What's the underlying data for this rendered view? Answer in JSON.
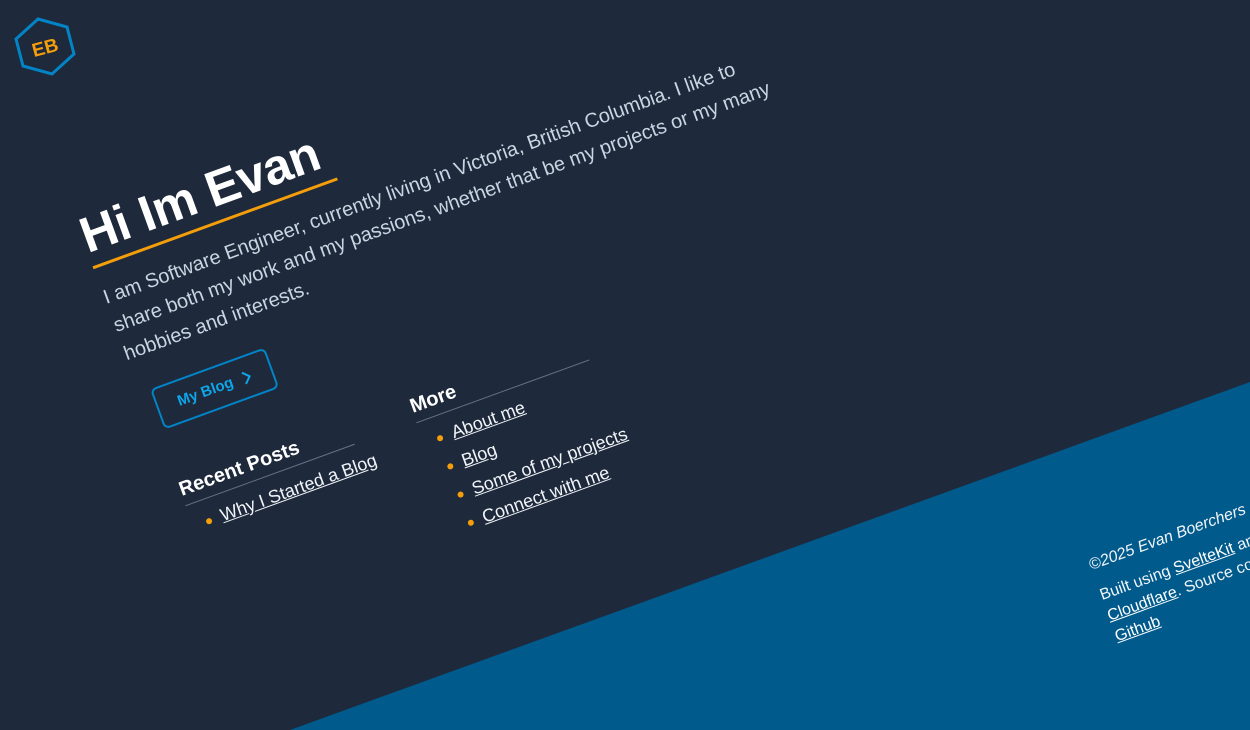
{
  "logo": {
    "initials": "EB"
  },
  "hero": {
    "title": "Hi Im Evan",
    "text": "I am Software Engineer, currently living in Victoria, British Columbia. I like to share both my work and my passions, whether that be my projects or my many hobbies and interests.",
    "button_label": "My Blog"
  },
  "recent_posts": {
    "title": "Recent Posts",
    "items": [
      "Why I Started a Blog"
    ]
  },
  "more": {
    "title": "More",
    "items": [
      "About me",
      "Blog",
      "Some of my projects",
      "Connect with me"
    ]
  },
  "footer": {
    "copyright": "©2025 Evan Boerchers",
    "built_prefix": "Built using ",
    "sveltekit": "SvelteKit",
    "built_and": " and",
    "cloudflare": "Cloudflare",
    "source_text": ". Source cod",
    "github": "Github"
  },
  "colors": {
    "background": "#1e293b",
    "footer_band": "#005a8c",
    "accent": "#f59e0b",
    "button": "#0284c7"
  }
}
